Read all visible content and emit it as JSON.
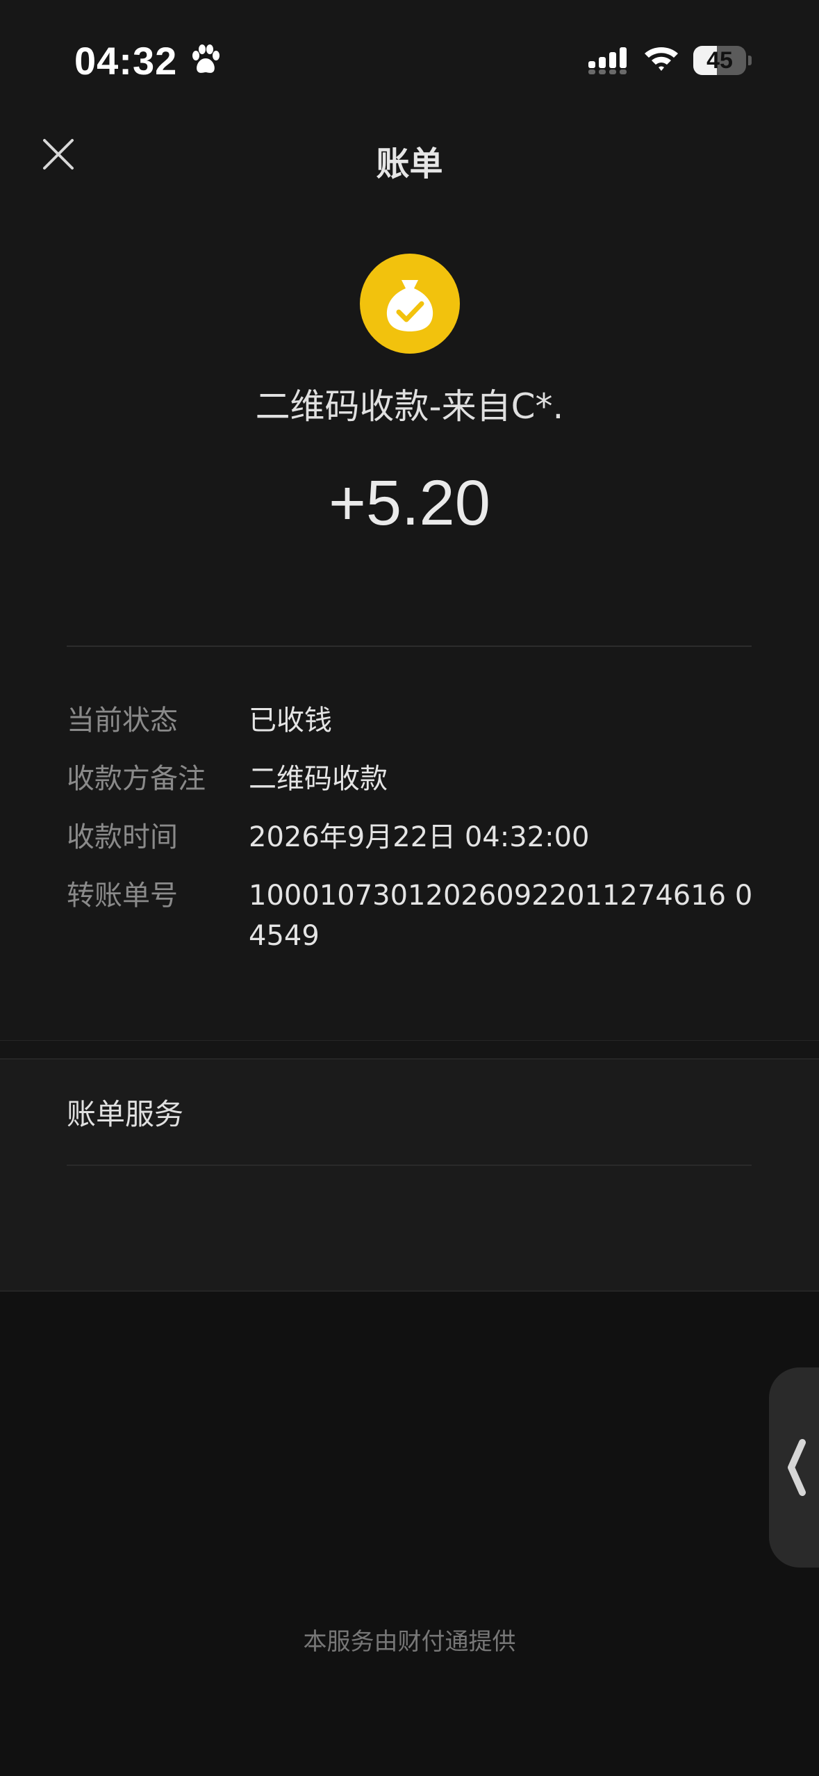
{
  "status_bar": {
    "time": "04:32",
    "battery_text": "45",
    "battery_level": 0.45,
    "icons": [
      "paw-icon",
      "signal-icon",
      "wifi-icon",
      "battery-icon"
    ]
  },
  "nav": {
    "title": "账单",
    "close_icon": "close-icon"
  },
  "transaction": {
    "icon": "money-bag-check-icon",
    "title": "二维码收款-来自C*.",
    "amount": "+5.20"
  },
  "details": [
    {
      "label": "当前状态",
      "value": "已收钱"
    },
    {
      "label": "收款方备注",
      "value": "二维码收款"
    },
    {
      "label": "收款时间",
      "value": "2026年9月22日 04:32:00"
    },
    {
      "label": "转账单号",
      "value": "100010730120260922011274616 04549"
    }
  ],
  "bill_service": {
    "title": "账单服务"
  },
  "side_handle": {
    "icon": "chevron-left-icon"
  },
  "footer": {
    "text": "本服务由财付通提供"
  },
  "colors": {
    "background": "#111111",
    "panel": "#171717",
    "accent_yellow": "#f2c20d",
    "label_gray": "#8a8a8a",
    "text_light": "#e6e6e6"
  }
}
